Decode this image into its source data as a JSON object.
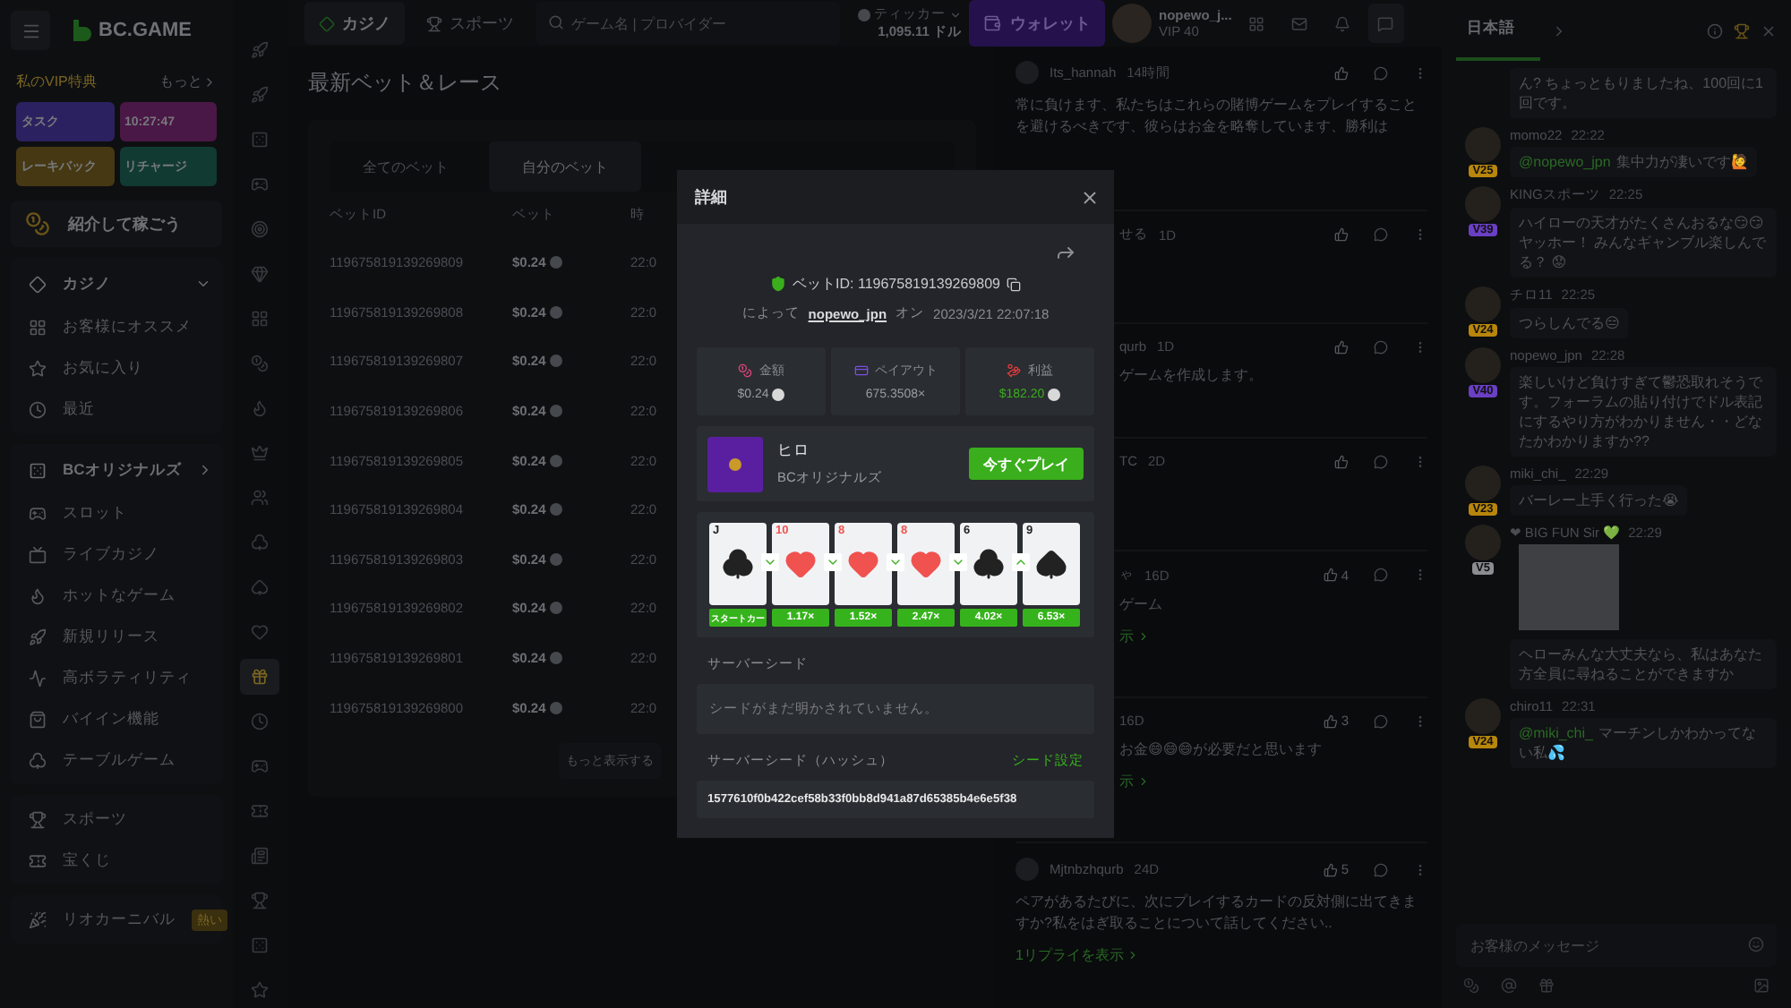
{
  "logo": "BC.GAME",
  "vip": {
    "title": "私のVIP特典",
    "more": "もっと",
    "tiles": [
      {
        "label": "タスク",
        "color": "#2c2160"
      },
      {
        "label": "10:27:47",
        "color": "#4a1846"
      },
      {
        "label": "レーキバック",
        "color": "#463812"
      },
      {
        "label": "リチャージ",
        "color": "#113a33"
      }
    ]
  },
  "referral": "紹介して稼ごう",
  "nav_groups": [
    {
      "items": [
        {
          "label": "カジノ",
          "kind": "section",
          "expanded": true
        },
        {
          "label": "お客様にオススメ",
          "kind": "item"
        },
        {
          "label": "お気に入り",
          "kind": "item"
        },
        {
          "label": "最近",
          "kind": "item"
        }
      ]
    },
    {
      "items": [
        {
          "label": "BCオリジナルズ",
          "kind": "section",
          "expanded": false
        },
        {
          "label": "スロット",
          "kind": "item"
        },
        {
          "label": "ライブカジノ",
          "kind": "item"
        },
        {
          "label": "ホットなゲーム",
          "kind": "item"
        },
        {
          "label": "新規リリース",
          "kind": "item"
        },
        {
          "label": "高ボラティリティ",
          "kind": "item"
        },
        {
          "label": "バイイン機能",
          "kind": "item"
        },
        {
          "label": "テーブルゲーム",
          "kind": "item"
        }
      ]
    },
    {
      "items": [
        {
          "label": "スポーツ",
          "kind": "item"
        },
        {
          "label": "宝くじ",
          "kind": "item"
        }
      ]
    },
    {
      "items": [
        {
          "label": "リオカーニバル",
          "kind": "item",
          "badge": "熱い"
        }
      ]
    }
  ],
  "rail": [
    {
      "selected": false
    },
    {
      "selected": false
    },
    {
      "selected": false
    },
    {
      "selected": false
    },
    {
      "selected": false
    },
    {
      "selected": false
    },
    {
      "selected": false
    },
    {
      "selected": false
    },
    {
      "selected": false
    },
    {
      "selected": false
    },
    {
      "selected": false
    },
    {
      "selected": false
    },
    {
      "selected": false
    },
    {
      "selected": false
    },
    {
      "selected": true
    },
    {
      "selected": false
    },
    {
      "selected": false
    },
    {
      "selected": false
    },
    {
      "selected": false
    },
    {
      "selected": false
    },
    {
      "selected": false
    },
    {
      "selected": false
    }
  ],
  "topbar": {
    "tabs": [
      {
        "label": "カジノ",
        "selected": true
      },
      {
        "label": "スポーツ",
        "selected": false
      }
    ],
    "search_placeholder": "ゲーム名 | プロバイダー",
    "ticker": {
      "label": "ティッカー",
      "amount": "1,095.11 ドル"
    },
    "wallet": "ウォレット",
    "user": {
      "name": "nopewo_j...",
      "vip": "VIP 40"
    }
  },
  "bets": {
    "title": "最新ベット＆レース",
    "tabs": [
      {
        "label": "全てのベット",
        "selected": false
      },
      {
        "label": "自分のベット",
        "selected": true
      }
    ],
    "columns": [
      "ベットID",
      "ベット",
      "時"
    ],
    "rows": [
      {
        "id": "119675819139269809",
        "bet": "$0.24",
        "time": "22:0"
      },
      {
        "id": "119675819139269808",
        "bet": "$0.24",
        "time": "22:0"
      },
      {
        "id": "119675819139269807",
        "bet": "$0.24",
        "time": "22:0"
      },
      {
        "id": "119675819139269806",
        "bet": "$0.24",
        "time": "22:0"
      },
      {
        "id": "119675819139269805",
        "bet": "$0.24",
        "time": "22:0"
      },
      {
        "id": "119675819139269804",
        "bet": "$0.24",
        "time": "22:0"
      },
      {
        "id": "119675819139269803",
        "bet": "$0.24",
        "time": "22:0"
      },
      {
        "id": "119675819139269802",
        "bet": "$0.24",
        "time": "22:0"
      },
      {
        "id": "119675819139269801",
        "bet": "$0.24",
        "time": "22:0"
      },
      {
        "id": "119675819139269800",
        "bet": "$0.24",
        "time": "22:0"
      }
    ],
    "more": "もっと表示する"
  },
  "forum": [
    {
      "user": "Its_hannah",
      "time": "14時間",
      "text": "常に負けます、私たちはこれらの賭博ゲームをプレイすることを避けるべきです、彼らはお金を略奪しています、勝利は"
    },
    {
      "user": "せる",
      "time": "1D"
    },
    {
      "user": "qurb",
      "time": "1D",
      "text": "ゲームを作成します。"
    },
    {
      "user": "TC",
      "time": "2D"
    },
    {
      "user": "ゃ",
      "time": "16D",
      "likes": "4",
      "text": "ゲーム",
      "link": "示"
    },
    {
      "time": "16D",
      "likes": "3",
      "text": "お金😄😄😄が必要だと思います",
      "link": "示"
    },
    {
      "user": "Mjtnbzhqurb",
      "time": "24D",
      "likes": "5",
      "text": "ペアがあるたびに、次にプレイするカードの反対側に出てきますか?私をはぎ取ることについて話してください..",
      "link": "1リプライを表示"
    }
  ],
  "chat": {
    "tab": "日本語",
    "placeholder": "お客様のメッセージ",
    "messages": [
      {
        "kind": "continuation",
        "text": "ん? ちょっともりましたね、100回に1回です。"
      },
      {
        "kind": "text",
        "user": "momo22",
        "time": "22:22",
        "vip": "V25",
        "color": "#b8860b",
        "mention": "@nopewo_jpn",
        "text": "集中力が凄いです🙋"
      },
      {
        "kind": "text",
        "user": "KINGスポーツ",
        "time": "22:25",
        "vip": "V39",
        "color": "#6a3fc4",
        "text": "ハイローの天才がたくさんおるな😏😏 ヤッホー！ みんなギャンブル楽しんでる？ 😟"
      },
      {
        "kind": "text",
        "user": "チロ11",
        "time": "22:25",
        "vip": "V24",
        "color": "#b8860b",
        "text": "つらしんでる😑"
      },
      {
        "kind": "text",
        "user": "nopewo_jpn",
        "time": "22:28",
        "vip": "V40",
        "color": "#6a3fc4",
        "text": "楽しいけど負けすぎて鬱恐取れそうです。フォーラムの貼り付けでドル表記にするやり方がわかりません・・どなたかわかりますか??"
      },
      {
        "kind": "text",
        "user": "miki_chi_",
        "time": "22:29",
        "vip": "V23",
        "color": "#b8860b",
        "text": "バーレー上手く行った😭"
      },
      {
        "kind": "image",
        "user": "❤ BIG FUN Sir 💚",
        "time": "22:29",
        "vip": "V5",
        "color": "#8a8d92"
      },
      {
        "kind": "continuation",
        "text": "ヘローみんな大丈夫なら、私はあなた方全員に尋ねることができますか"
      },
      {
        "kind": "text",
        "user": "chiro11",
        "time": "22:31",
        "vip": "V24",
        "color": "#b8860b",
        "mention": "@miki_chi_",
        "text": "マーチンしかわかってない私💦"
      }
    ]
  },
  "detail": {
    "title": "詳細",
    "bet_id": "ベットID: 119675819139269809",
    "by": "によって",
    "user": "nopewo_jpn",
    "on": "オン",
    "date": "2023/3/21 22:07:18",
    "stats": [
      {
        "kind": "amount",
        "label": "金額",
        "value": "$0.24"
      },
      {
        "kind": "payout",
        "label": "ペイアウト",
        "value": "675.3508×"
      },
      {
        "kind": "profit",
        "label": "利益",
        "value": "$182.20"
      }
    ],
    "game": {
      "name": "ヒロ",
      "provider": "BCオリジナルズ",
      "play": "今すぐプレイ"
    },
    "cards": [
      {
        "rank": "J",
        "kind": "club",
        "label": "スタートカー"
      },
      {
        "rank": "10",
        "kind": "heart",
        "label": "1.17×",
        "higher": false
      },
      {
        "rank": "8",
        "kind": "heart",
        "label": "1.52×",
        "higher": false
      },
      {
        "rank": "8",
        "kind": "heart",
        "label": "2.47×",
        "higher": false
      },
      {
        "rank": "6",
        "kind": "club",
        "label": "4.02×",
        "higher": false
      },
      {
        "rank": "9",
        "kind": "spade",
        "label": "6.53×",
        "higher": true
      }
    ],
    "seed_label": "サーバーシード",
    "seed_value": "シードがまだ明かされていません。",
    "hash_label": "サーバーシード（ハッシュ）",
    "seed_link": "シード設定",
    "hash": "1577610f0b422cef58b33f0bb8d941a87d65385b4e6e5f38"
  }
}
